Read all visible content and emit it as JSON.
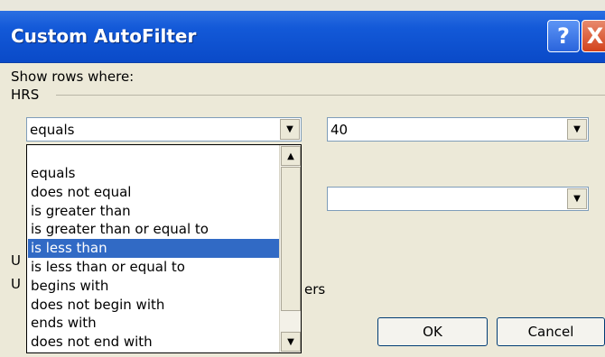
{
  "dialog": {
    "title": "Custom AutoFilter",
    "help_label": "?",
    "close_label": "X"
  },
  "show_rows_label": "Show rows where:",
  "field_name": "HRS",
  "criteria1": {
    "operator": "equals",
    "value": "40"
  },
  "criteria2": {
    "operator": "",
    "value": ""
  },
  "partial_labels": {
    "use_q": "U",
    "use_star": "U",
    "ers": "ers"
  },
  "operator_options": [
    "equals",
    "does not equal",
    "is greater than",
    "is greater than or equal to",
    "is less than",
    "is less than or equal to",
    "begins with",
    "does not begin with",
    "ends with",
    "does not end with"
  ],
  "selected_option": "is less than",
  "buttons": {
    "ok": "OK",
    "cancel": "Cancel"
  },
  "colors": {
    "titlebar": "#0a4ac8",
    "highlight": "#316ac5",
    "dialog_bg": "#ece9d8"
  }
}
